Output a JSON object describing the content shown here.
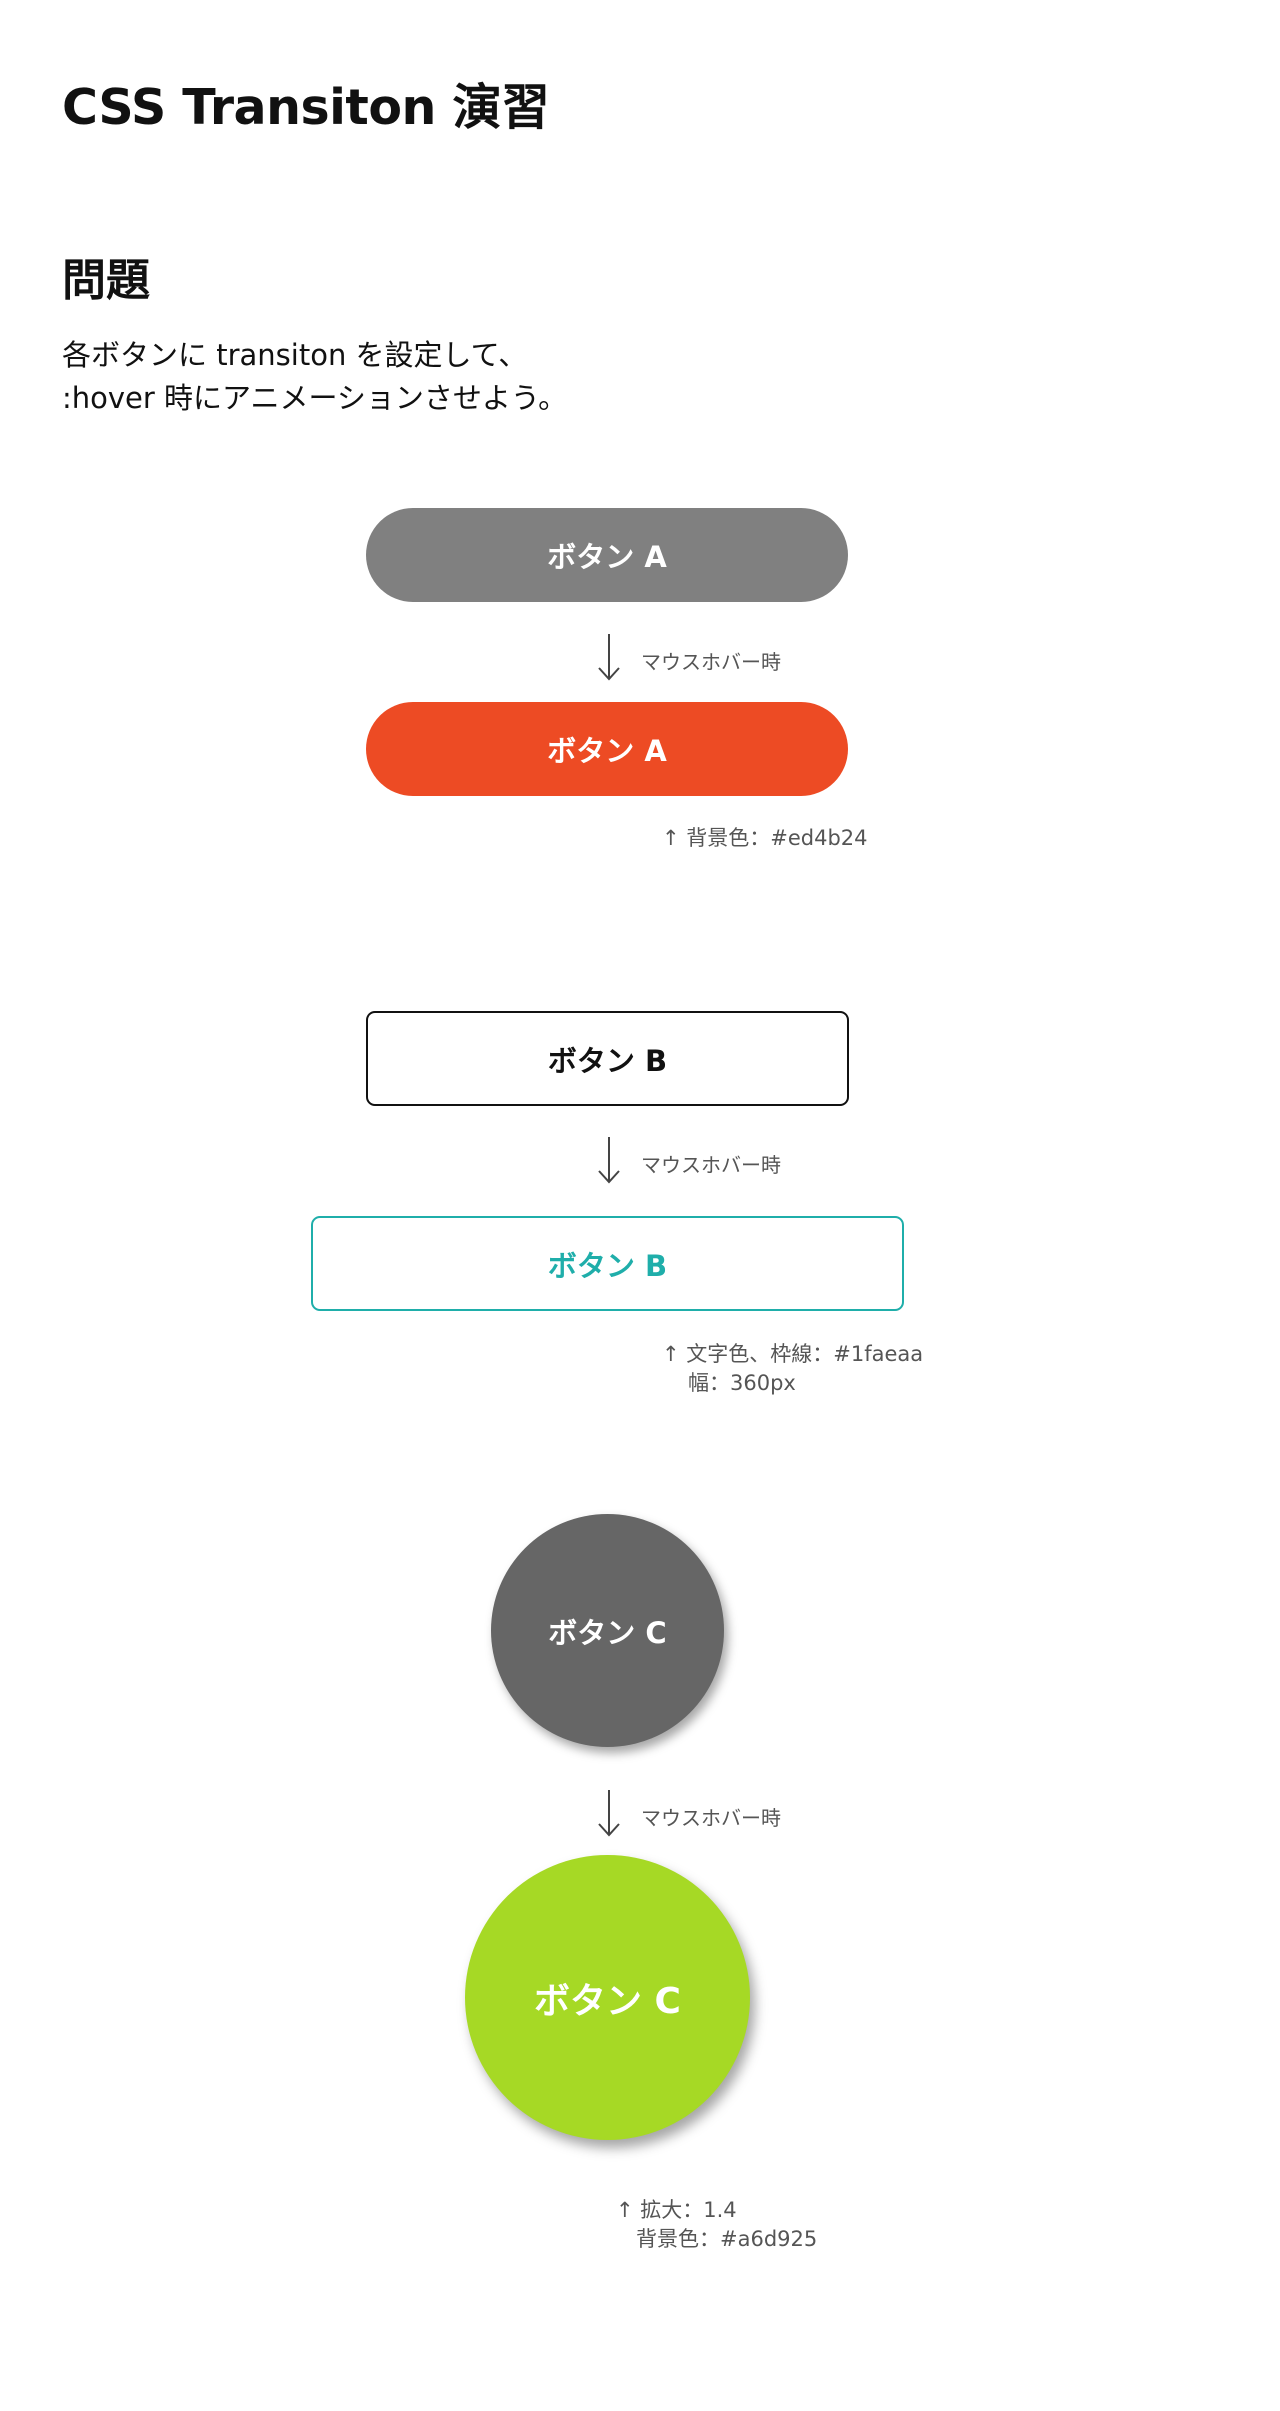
{
  "header": {
    "title": "CSS Transiton 演習"
  },
  "problem": {
    "heading": "問題",
    "lines": [
      "各ボタンに transiton を設定して、",
      ":hover 時にアニメーションさせよう。"
    ]
  },
  "hover_label": "マウスホバー時",
  "button_a": {
    "default_label": "ボタン A",
    "hover_label": "ボタン A",
    "default_color": "#808080",
    "hover_color": "#ed4b24",
    "note": "↑ 背景色：#ed4b24"
  },
  "button_b": {
    "default_label": "ボタン B",
    "hover_label": "ボタン B",
    "hover_color": "#1faeaa",
    "note_line1": "↑ 文字色、枠線：#1faeaa",
    "note_line2": "幅：360px"
  },
  "button_c": {
    "default_label": "ボタン C",
    "hover_label": "ボタン C",
    "default_color": "#666666",
    "hover_color": "#a6d925",
    "note_line1": "↑ 拡大：1.4",
    "note_line2": "背景色：#a6d925"
  }
}
